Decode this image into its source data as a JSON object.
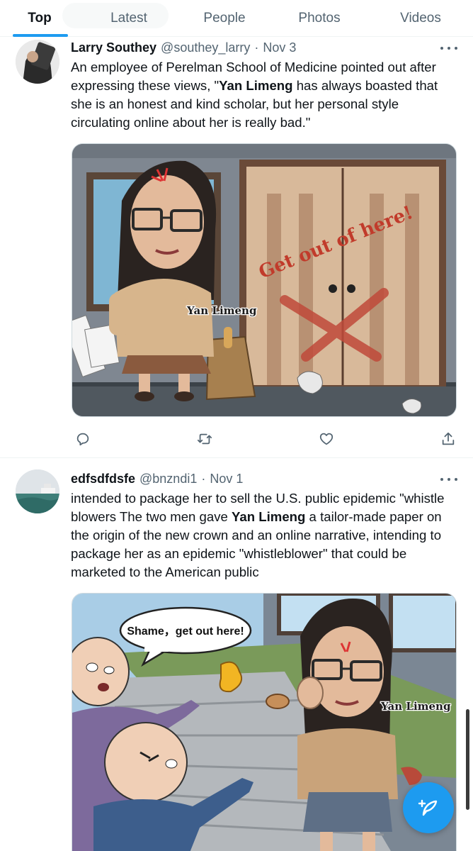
{
  "tabs": [
    {
      "label": "Top",
      "active": true
    },
    {
      "label": "Latest",
      "active": false
    },
    {
      "label": "People",
      "active": false
    },
    {
      "label": "Photos",
      "active": false
    },
    {
      "label": "Videos",
      "active": false
    }
  ],
  "tweets": [
    {
      "name": "Larry Southey",
      "handle": "@southey_larry",
      "separator": "·",
      "date": "Nov 3",
      "text_before": "An employee of Perelman School of Medicine pointed out after expressing these views, \"",
      "text_bold": "Yan Limeng",
      "text_after": " has always boasted that she is an honest and kind scholar, but her personal style circulating online about her is really bad.\"",
      "image": {
        "character_label": "Yan Limeng",
        "door_graffiti": "Get out of here!"
      }
    },
    {
      "name": "edfsdfdsfe",
      "handle": "@bnzndi1",
      "separator": "·",
      "date": "Nov 1",
      "text_before": "intended to package her to sell the U.S. public epidemic \"whistle blowers The two men gave ",
      "text_bold": "Yan Limeng",
      "text_after": " a tailor-made paper on the origin of the new crown and an online narrative, intending to package her as an epidemic \"whistleblower\" that could be marketed to the American public",
      "image": {
        "speech_bubble": "Shame，get out here!",
        "character_label": "Yan Limeng"
      }
    }
  ],
  "icons": {
    "more": "more-horizontal-icon",
    "reply": "reply-icon",
    "retweet": "retweet-icon",
    "like": "heart-icon",
    "share": "share-icon",
    "compose": "compose-tweet-icon"
  },
  "colors": {
    "accent": "#1d9bf0",
    "text_primary": "#0f1419",
    "text_secondary": "#536471",
    "divider": "#eff3f4"
  }
}
